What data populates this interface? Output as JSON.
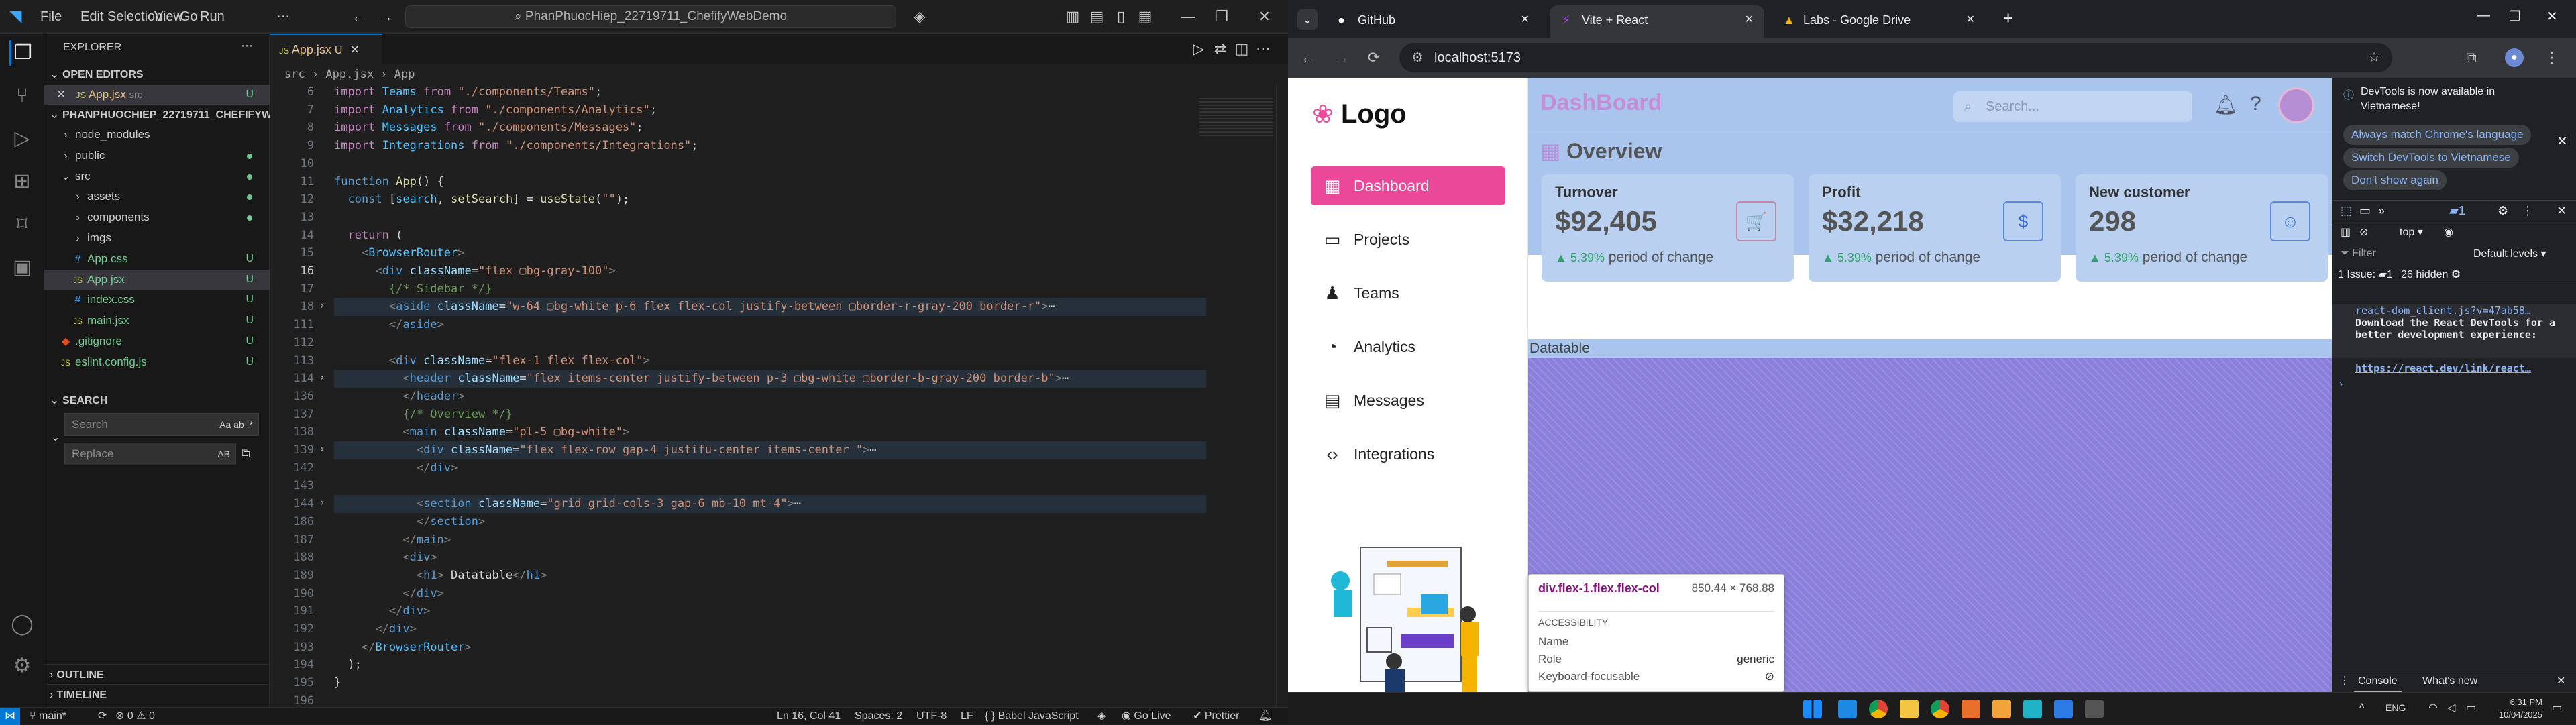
{
  "vscode": {
    "menus": [
      "File",
      "Edit",
      "Selection",
      "View",
      "Go",
      "Run",
      "⋯"
    ],
    "command_center": "PhanPhuocHiep_22719711_ChefifyWebDemo",
    "explorer_title": "EXPLORER",
    "open_editors": "OPEN EDITORS",
    "open_file": "App.jsx",
    "open_file_dir": "src",
    "project": "PHANPHUOCHIEP_22719711_CHEFIFYW...",
    "tree": [
      {
        "name": "node_modules",
        "indent": 1,
        "kind": "folder",
        "badge": ""
      },
      {
        "name": "public",
        "indent": 1,
        "kind": "folder",
        "badge": "dot"
      },
      {
        "name": "src",
        "indent": 1,
        "kind": "folder-open",
        "badge": "dot"
      },
      {
        "name": "assets",
        "indent": 2,
        "kind": "folder",
        "badge": "dot"
      },
      {
        "name": "components",
        "indent": 2,
        "kind": "folder",
        "badge": "dot"
      },
      {
        "name": "imgs",
        "indent": 2,
        "kind": "folder",
        "badge": ""
      },
      {
        "name": "App.css",
        "indent": 2,
        "kind": "css",
        "badge": "U"
      },
      {
        "name": "App.jsx",
        "indent": 2,
        "kind": "js",
        "badge": "U"
      },
      {
        "name": "index.css",
        "indent": 2,
        "kind": "css",
        "badge": "U"
      },
      {
        "name": "main.jsx",
        "indent": 2,
        "kind": "js",
        "badge": "U"
      },
      {
        "name": ".gitignore",
        "indent": 1,
        "kind": "git",
        "badge": "U"
      },
      {
        "name": "eslint.config.js",
        "indent": 1,
        "kind": "js",
        "badge": "U"
      }
    ],
    "search_title": "SEARCH",
    "search_placeholder": "Search",
    "replace_placeholder": "Replace",
    "outline": "OUTLINE",
    "timeline": "TIMELINE",
    "tab": "App.jsx",
    "tab_badge": "U",
    "breadcrumb": "src  ›  App.jsx  ›  App",
    "code": [
      {
        "n": "6",
        "html": "<span class='k'>import</span> <span class='v'>Teams</span> <span class='k'>from</span> <span class='s'>\"./components/Teams\"</span>;"
      },
      {
        "n": "7",
        "html": "<span class='k'>import</span> <span class='v'>Analytics</span> <span class='k'>from</span> <span class='s'>\"./components/Analytics\"</span>;"
      },
      {
        "n": "8",
        "html": "<span class='k'>import</span> <span class='v'>Messages</span> <span class='k'>from</span> <span class='s'>\"./components/Messages\"</span>;"
      },
      {
        "n": "9",
        "html": "<span class='k'>import</span> <span class='v'>Integrations</span> <span class='k'>from</span> <span class='s'>\"./components/Integrations\"</span>;"
      },
      {
        "n": "10",
        "html": ""
      },
      {
        "n": "11",
        "html": "<span class='t'>function</span> <span class='f'>App</span>() {"
      },
      {
        "n": "12",
        "html": "  <span class='t'>const</span> [<span class='v'>search</span>, <span class='f'>setSearch</span>] = <span class='f'>useState</span>(<span class='s'>\"\"</span>);"
      },
      {
        "n": "13",
        "html": ""
      },
      {
        "n": "14",
        "html": "  <span class='k'>return</span> ("
      },
      {
        "n": "15",
        "html": "    <span class='tg'>&lt;</span><span class='v'>BrowserRouter</span><span class='tg'>&gt;</span>"
      },
      {
        "n": "16",
        "html": "      <span class='tg'>&lt;</span><span class='t'>div</span> <span class='a'>className</span>=<span class='s'>\"flex ▢bg-gray-100\"</span><span class='tg'>&gt;</span>",
        "cur": true
      },
      {
        "n": "17",
        "html": "        <span class='cm'>{/* Sidebar */}</span>"
      },
      {
        "n": "18",
        "html": "        <span class='tg'>&lt;</span><span class='t'>aside</span> <span class='a'>className</span>=<span class='s'>\"w-64 ▢bg-white p-6 flex flex-col justify-between ▢border-r-gray-200 border-r\"</span><span class='tg'>&gt;</span>⋯",
        "hl": true,
        "fold": true
      },
      {
        "n": "111",
        "html": "        <span class='tg'>&lt;/</span><span class='t'>aside</span><span class='tg'>&gt;</span>"
      },
      {
        "n": "112",
        "html": ""
      },
      {
        "n": "113",
        "html": "        <span class='tg'>&lt;</span><span class='t'>div</span> <span class='a'>className</span>=<span class='s'>\"flex-1 flex flex-col\"</span><span class='tg'>&gt;</span>"
      },
      {
        "n": "114",
        "html": "          <span class='tg'>&lt;</span><span class='t'>header</span> <span class='a'>className</span>=<span class='s'>\"flex items-center justify-between p-3 ▢bg-white ▢border-b-gray-200 border-b\"</span><span class='tg'>&gt;</span>⋯",
        "hl": true,
        "fold": true
      },
      {
        "n": "136",
        "html": "          <span class='tg'>&lt;/</span><span class='t'>header</span><span class='tg'>&gt;</span>"
      },
      {
        "n": "137",
        "html": "          <span class='cm'>{/* Overview */}</span>"
      },
      {
        "n": "138",
        "html": "          <span class='tg'>&lt;</span><span class='t'>main</span> <span class='a'>className</span>=<span class='s'>\"pl-5 ▢bg-white\"</span><span class='tg'>&gt;</span>"
      },
      {
        "n": "139",
        "html": "            <span class='tg'>&lt;</span><span class='t'>div</span> <span class='a'>className</span>=<span class='s'>\"flex flex-row gap-4 justifu-center items-center \"</span><span class='tg'>&gt;</span>⋯",
        "hl": true,
        "fold": true
      },
      {
        "n": "142",
        "html": "            <span class='tg'>&lt;/</span><span class='t'>div</span><span class='tg'>&gt;</span>"
      },
      {
        "n": "143",
        "html": ""
      },
      {
        "n": "144",
        "html": "            <span class='tg'>&lt;</span><span class='t'>section</span> <span class='a'>className</span>=<span class='s'>\"grid grid-cols-3 gap-6 mb-10 mt-4\"</span><span class='tg'>&gt;</span>⋯",
        "hl": true,
        "fold": true
      },
      {
        "n": "186",
        "html": "            <span class='tg'>&lt;/</span><span class='t'>section</span><span class='tg'>&gt;</span>"
      },
      {
        "n": "187",
        "html": "          <span class='tg'>&lt;/</span><span class='t'>main</span><span class='tg'>&gt;</span>"
      },
      {
        "n": "188",
        "html": "          <span class='tg'>&lt;</span><span class='t'>div</span><span class='tg'>&gt;</span>"
      },
      {
        "n": "189",
        "html": "            <span class='tg'>&lt;</span><span class='t'>h1</span><span class='tg'>&gt;</span> Datatable<span class='tg'>&lt;/</span><span class='t'>h1</span><span class='tg'>&gt;</span>"
      },
      {
        "n": "190",
        "html": "          <span class='tg'>&lt;/</span><span class='t'>div</span><span class='tg'>&gt;</span>"
      },
      {
        "n": "191",
        "html": "        <span class='tg'>&lt;/</span><span class='t'>div</span><span class='tg'>&gt;</span>"
      },
      {
        "n": "192",
        "html": "      <span class='tg'>&lt;/</span><span class='t'>div</span><span class='tg'>&gt;</span>"
      },
      {
        "n": "193",
        "html": "    <span class='tg'>&lt;/</span><span class='v'>BrowserRouter</span><span class='tg'>&gt;</span>"
      },
      {
        "n": "194",
        "html": "  );"
      },
      {
        "n": "195",
        "html": "}"
      },
      {
        "n": "196",
        "html": ""
      }
    ],
    "status": {
      "branch": "main*",
      "problems": "⊗ 0 ⚠ 0",
      "position": "Ln 16, Col 41",
      "spaces": "Spaces: 2",
      "encoding": "UTF-8",
      "eol": "LF",
      "language": "{ } Babel JavaScript",
      "golive": "Go Live",
      "prettier": "✔ Prettier"
    }
  },
  "chrome": {
    "tabs": [
      {
        "label": "GitHub",
        "active": false
      },
      {
        "label": "Vite + React",
        "active": true
      },
      {
        "label": "Labs - Google Drive",
        "active": false
      }
    ],
    "url": "localhost:5173",
    "app": {
      "logo": "Logo",
      "nav": [
        {
          "label": "Dashboard",
          "icon": "▦",
          "active": true
        },
        {
          "label": "Projects",
          "icon": "▭",
          "active": false
        },
        {
          "label": "Teams",
          "icon": "♟",
          "active": false
        },
        {
          "label": "Analytics",
          "icon": "◔",
          "active": false
        },
        {
          "label": "Messages",
          "icon": "▤",
          "active": false
        },
        {
          "label": "Integrations",
          "icon": "‹›",
          "active": false
        }
      ],
      "title": "DashBoard",
      "search_placeholder": "Search...",
      "overview": "Overview",
      "cards": [
        {
          "label": "Turnover",
          "value": "$92,405",
          "change": "▲ 5.39%",
          "period": "period of change",
          "icon": "🛒"
        },
        {
          "label": "Profit",
          "value": "$32,218",
          "change": "▲ 5.39%",
          "period": "period of change",
          "icon": "$"
        },
        {
          "label": "New customer",
          "value": "298",
          "change": "▲ 5.39%",
          "period": "period of change",
          "icon": "☺"
        }
      ],
      "datatable": "Datatable",
      "tooltip": {
        "selector": "div.flex-1.flex.flex-col",
        "size": "850.44 × 768.88",
        "section": "ACCESSIBILITY",
        "rows": [
          {
            "k": "Name",
            "v": ""
          },
          {
            "k": "Role",
            "v": "generic"
          },
          {
            "k": "Keyboard-focusable",
            "v": "⊘"
          }
        ]
      }
    },
    "devtools": {
      "notice": "DevTools is now available in Vietnamese!",
      "btn1": "Always match Chrome's language",
      "btn2": "Switch DevTools to Vietnamese",
      "btn3": "Don't show again",
      "context": "top ▾",
      "filter": "Filter",
      "levels": "Default levels ▾",
      "issues": "1 Issue: ▰1",
      "hidden": "26 hidden",
      "link_file": "react-dom_client.js?v=47ab58…",
      "message": "Download the React DevTools for a better development experience:",
      "link": "https://react.dev/link/react…",
      "console_tab": "Console",
      "whatsnew_tab": "What's new"
    },
    "taskbar": {
      "lang": "ENG",
      "time": "6:31 PM",
      "date": "10/04/2025"
    }
  }
}
